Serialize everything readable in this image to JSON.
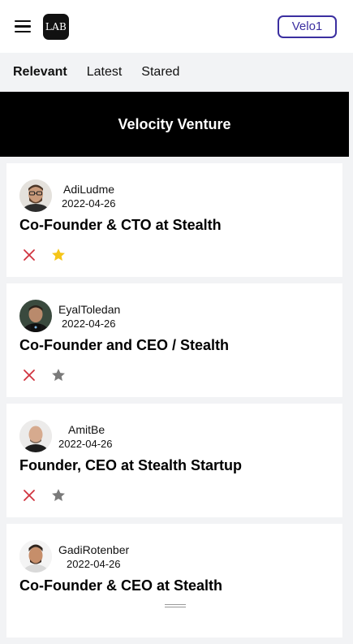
{
  "header": {
    "logo_text": "LAB",
    "account_label": "Velo1",
    "accent_color": "#3b2fa0"
  },
  "tabs": [
    {
      "label": "Relevant",
      "active": true
    },
    {
      "label": "Latest",
      "active": false
    },
    {
      "label": "Stared",
      "active": false
    }
  ],
  "banner": {
    "title": "Velocity Venture"
  },
  "feed": [
    {
      "name": "AdiLudme",
      "date": "2022-04-26",
      "title": "Co-Founder & CTO at Stealth",
      "starred": true
    },
    {
      "name": "EyalToledan",
      "date": "2022-04-26",
      "title": "Co-Founder and CEO / Stealth",
      "starred": false
    },
    {
      "name": "AmitBe",
      "date": "2022-04-26",
      "title": "Founder, CEO at Stealth Startup",
      "starred": false
    },
    {
      "name": "GadiRotenber",
      "date": "2022-04-26",
      "title": "Co-Founder & CEO at Stealth",
      "starred": false
    }
  ],
  "colors": {
    "dismiss": "#d0343f",
    "star_active": "#f5c518",
    "star_inactive": "#7a7a7a"
  }
}
